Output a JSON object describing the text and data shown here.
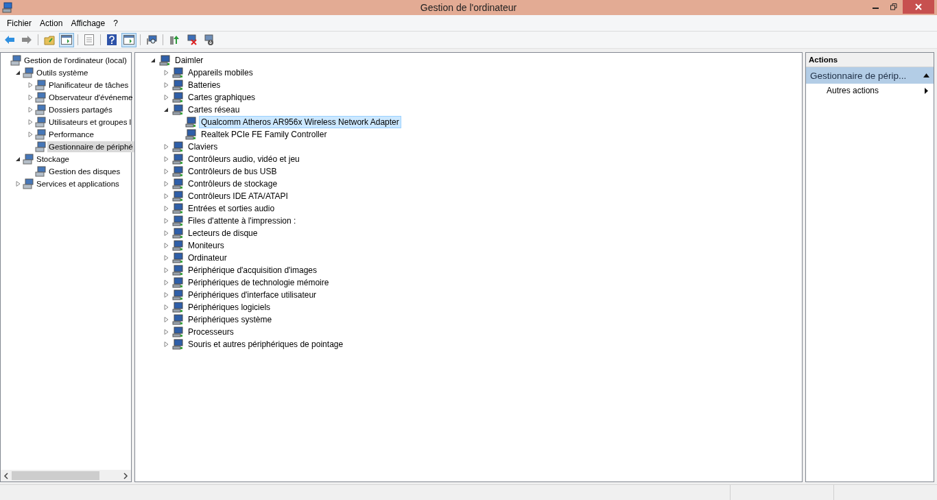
{
  "window": {
    "title": "Gestion de l'ordinateur"
  },
  "menu": [
    "Fichier",
    "Action",
    "Affichage",
    "?"
  ],
  "toolbar": [
    {
      "kind": "back",
      "pressed": false
    },
    {
      "kind": "forward",
      "pressed": false
    },
    {
      "kind": "separator"
    },
    {
      "kind": "up",
      "pressed": false
    },
    {
      "kind": "tree-pane",
      "pressed": true
    },
    {
      "kind": "separator"
    },
    {
      "kind": "properties",
      "pressed": false
    },
    {
      "kind": "separator"
    },
    {
      "kind": "help",
      "pressed": false
    },
    {
      "kind": "action-pane",
      "pressed": true
    },
    {
      "kind": "separator"
    },
    {
      "kind": "scan",
      "pressed": false
    },
    {
      "kind": "separator"
    },
    {
      "kind": "update",
      "pressed": false
    },
    {
      "kind": "remove",
      "pressed": false
    },
    {
      "kind": "install",
      "pressed": false
    }
  ],
  "nav_tree": [
    {
      "label": "Gestion de l'ordinateur (local)",
      "selected": false,
      "children": [
        {
          "label": "Outils système",
          "selected": false,
          "expanded": true,
          "children": [
            {
              "label": "Planificateur de tâches",
              "selected": false,
              "expanded": false
            },
            {
              "label": "Observateur d'événeme",
              "selected": false,
              "expanded": false
            },
            {
              "label": "Dossiers partagés",
              "selected": false,
              "expanded": false
            },
            {
              "label": "Utilisateurs et groupes l",
              "selected": false,
              "expanded": false
            },
            {
              "label": "Performance",
              "selected": false,
              "expanded": false
            },
            {
              "label": "Gestionnaire de périphé",
              "selected": true
            }
          ]
        },
        {
          "label": "Stockage",
          "selected": false,
          "expanded": true,
          "children": [
            {
              "label": "Gestion des disques",
              "selected": false
            }
          ]
        },
        {
          "label": "Services et applications",
          "selected": false,
          "expanded": false
        }
      ]
    }
  ],
  "device_tree": [
    {
      "label": "Daimler",
      "selected": false,
      "expanded": true,
      "children": [
        {
          "label": "Appareils mobiles",
          "selected": false,
          "expanded": false
        },
        {
          "label": "Batteries",
          "selected": false,
          "expanded": false
        },
        {
          "label": "Cartes graphiques",
          "selected": false,
          "expanded": false
        },
        {
          "label": "Cartes réseau",
          "selected": false,
          "expanded": true,
          "children": [
            {
              "label": "Qualcomm Atheros AR956x Wireless Network Adapter",
              "selected": true
            },
            {
              "label": "Realtek PCIe FE Family Controller",
              "selected": false
            }
          ]
        },
        {
          "label": "Claviers",
          "selected": false,
          "expanded": false
        },
        {
          "label": "Contrôleurs audio, vidéo et jeu",
          "selected": false,
          "expanded": false
        },
        {
          "label": "Contrôleurs de bus USB",
          "selected": false,
          "expanded": false
        },
        {
          "label": "Contrôleurs de stockage",
          "selected": false,
          "expanded": false
        },
        {
          "label": "Contrôleurs IDE ATA/ATAPI",
          "selected": false,
          "expanded": false
        },
        {
          "label": "Entrées et sorties audio",
          "selected": false,
          "expanded": false
        },
        {
          "label": "Files d'attente à l'impression :",
          "selected": false,
          "expanded": false
        },
        {
          "label": "Lecteurs de disque",
          "selected": false,
          "expanded": false
        },
        {
          "label": "Moniteurs",
          "selected": false,
          "expanded": false
        },
        {
          "label": "Ordinateur",
          "selected": false,
          "expanded": false
        },
        {
          "label": "Périphérique d'acquisition d'images",
          "selected": false,
          "expanded": false
        },
        {
          "label": "Périphériques de technologie mémoire",
          "selected": false,
          "expanded": false
        },
        {
          "label": "Périphériques d'interface utilisateur",
          "selected": false,
          "expanded": false
        },
        {
          "label": "Périphériques logiciels",
          "selected": false,
          "expanded": false
        },
        {
          "label": "Périphériques système",
          "selected": false,
          "expanded": false
        },
        {
          "label": "Processeurs",
          "selected": false,
          "expanded": false
        },
        {
          "label": "Souris et autres périphériques de pointage",
          "selected": false,
          "expanded": false
        }
      ]
    }
  ],
  "actions": {
    "header": "Actions",
    "section": {
      "title": "Gestionnaire de périp...",
      "expanded": true
    },
    "items": [
      "Autres actions"
    ]
  }
}
